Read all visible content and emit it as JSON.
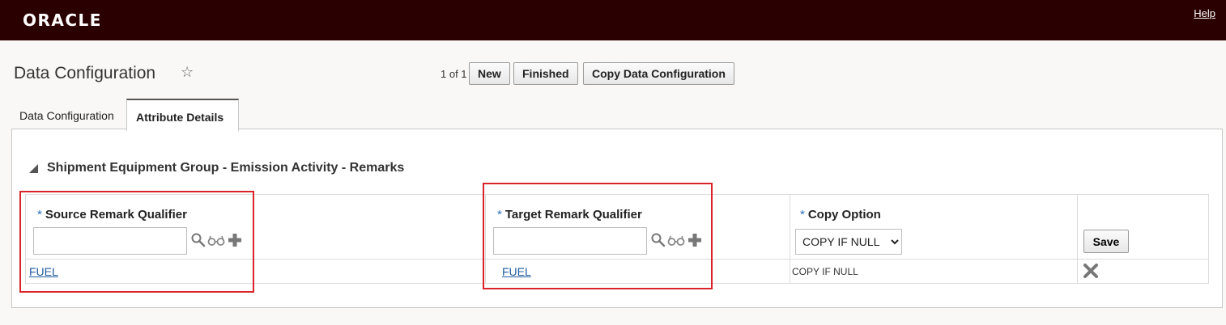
{
  "header": {
    "logo": "ORACLE",
    "help": "Help"
  },
  "page": {
    "title": "Data Configuration",
    "pager": "1 of 1"
  },
  "toolbar": {
    "new": "New",
    "finished": "Finished",
    "copy": "Copy Data Configuration"
  },
  "tabs": [
    {
      "label": "Data Configuration"
    },
    {
      "label": "Attribute Details"
    }
  ],
  "section": {
    "title": "Shipment Equipment Group - Emission Activity - Remarks"
  },
  "grid": {
    "required_marker": "*",
    "columns": [
      {
        "label": "Source Remark Qualifier"
      },
      {
        "label": "Target Remark Qualifier"
      },
      {
        "label": "Copy Option"
      }
    ],
    "source_input": {
      "value": ""
    },
    "target_input": {
      "value": ""
    },
    "copy_option_select": {
      "selected": "COPY IF NULL"
    },
    "save_label": "Save",
    "rows": [
      {
        "source": "FUEL",
        "target": "FUEL",
        "copy_option": "COPY IF NULL"
      }
    ]
  },
  "colors": {
    "header_bg": "#2b0000",
    "link": "#1f5c9e",
    "required": "#2a6fc4",
    "highlight": "#d8232a"
  }
}
